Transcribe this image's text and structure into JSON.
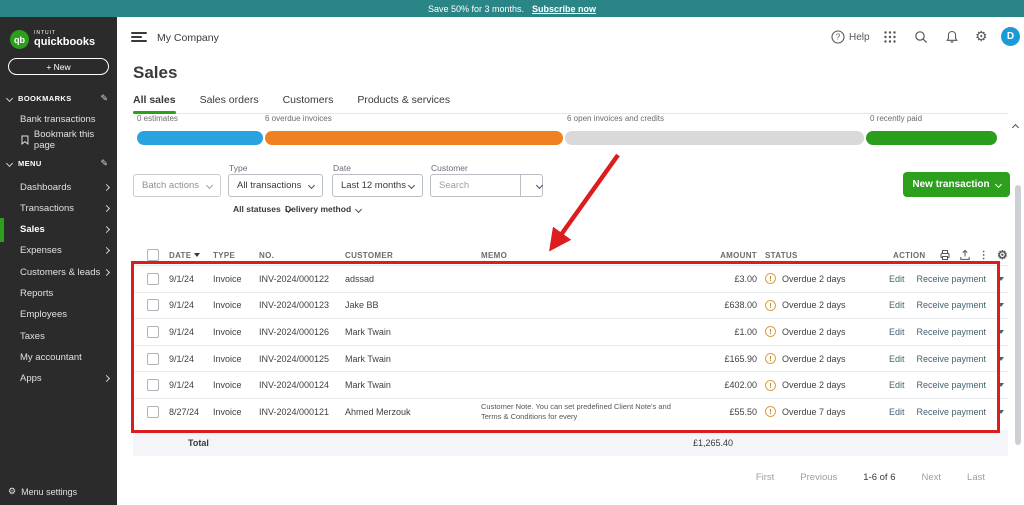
{
  "banner": {
    "text": "Save 50% for 3 months.",
    "link": "Subscribe now"
  },
  "sidebar": {
    "brand_top": "INTUIT",
    "brand_name": "quickbooks",
    "new_button": "+ New",
    "bookmarks_header": "BOOKMARKS",
    "bookmark_items": [
      "Bank transactions",
      "Bookmark this page"
    ],
    "menu_header": "MENU",
    "menu_items": [
      {
        "label": "Dashboards",
        "expandable": true,
        "active": false
      },
      {
        "label": "Transactions",
        "expandable": true,
        "active": false
      },
      {
        "label": "Sales",
        "expandable": true,
        "active": true
      },
      {
        "label": "Expenses",
        "expandable": true,
        "active": false
      },
      {
        "label": "Customers & leads",
        "expandable": true,
        "active": false
      },
      {
        "label": "Reports",
        "expandable": false,
        "active": false
      },
      {
        "label": "Employees",
        "expandable": false,
        "active": false
      },
      {
        "label": "Taxes",
        "expandable": false,
        "active": false
      },
      {
        "label": "My accountant",
        "expandable": false,
        "active": false
      },
      {
        "label": "Apps",
        "expandable": true,
        "active": false
      }
    ],
    "menu_settings": "Menu settings"
  },
  "topbar": {
    "company": "My Company",
    "help_label": "Help",
    "avatar_initial": "D"
  },
  "page_title": "Sales",
  "tabs": [
    {
      "label": "All sales",
      "active": true
    },
    {
      "label": "Sales orders",
      "active": false
    },
    {
      "label": "Customers",
      "active": false
    },
    {
      "label": "Products & services",
      "active": false
    }
  ],
  "money_bar": {
    "segments": [
      {
        "label": "0 estimates",
        "color": "#29a3e0",
        "width_pct": 14.7,
        "label_left": 20
      },
      {
        "label": "6 overdue invoices",
        "color": "#ef8122",
        "width_pct": 35.0,
        "label_left": 148
      },
      {
        "label": "6 open invoices and credits",
        "color": "#d9d9d9",
        "width_pct": 35.0,
        "label_left": 450
      },
      {
        "label": "0 recently paid",
        "color": "#2a9e1c",
        "width_pct": 15.3,
        "label_left": 753
      }
    ]
  },
  "filters": {
    "batch_actions": "Batch actions",
    "type_label": "Type",
    "type_value": "All transactions",
    "date_label": "Date",
    "date_value": "Last 12 months",
    "customer_label": "Customer",
    "customer_placeholder": "Search",
    "status_filter": "All statuses",
    "delivery_filter": "Delivery method"
  },
  "new_transaction_button": "New transaction",
  "table": {
    "headers": {
      "date": "DATE",
      "type": "TYPE",
      "no": "NO.",
      "customer": "CUSTOMER",
      "memo": "MEMO",
      "amount": "AMOUNT",
      "status": "STATUS",
      "action": "ACTION"
    },
    "rows": [
      {
        "date": "9/1/24",
        "type": "Invoice",
        "no": "INV-2024/000122",
        "customer": "adssad",
        "memo": "",
        "amount": "£3.00",
        "status": "Overdue 2 days",
        "actions": [
          "Edit",
          "Receive payment"
        ]
      },
      {
        "date": "9/1/24",
        "type": "Invoice",
        "no": "INV-2024/000123",
        "customer": "Jake BB",
        "memo": "",
        "amount": "£638.00",
        "status": "Overdue 2 days",
        "actions": [
          "Edit",
          "Receive payment"
        ]
      },
      {
        "date": "9/1/24",
        "type": "Invoice",
        "no": "INV-2024/000126",
        "customer": "Mark Twain",
        "memo": "",
        "amount": "£1.00",
        "status": "Overdue 2 days",
        "actions": [
          "Edit",
          "Receive payment"
        ]
      },
      {
        "date": "9/1/24",
        "type": "Invoice",
        "no": "INV-2024/000125",
        "customer": "Mark Twain",
        "memo": "",
        "amount": "£165.90",
        "status": "Overdue 2 days",
        "actions": [
          "Edit",
          "Receive payment"
        ]
      },
      {
        "date": "9/1/24",
        "type": "Invoice",
        "no": "INV-2024/000124",
        "customer": "Mark Twain",
        "memo": "",
        "amount": "£402.00",
        "status": "Overdue 2 days",
        "actions": [
          "Edit",
          "Receive payment"
        ]
      },
      {
        "date": "8/27/24",
        "type": "Invoice",
        "no": "INV-2024/000121",
        "customer": "Ahmed Merzouk",
        "memo": "Customer Note. You can set predefined Client Note's and Terms & Conditions for every",
        "amount": "£55.50",
        "status": "Overdue 7 days",
        "actions": [
          "Edit",
          "Receive payment"
        ]
      }
    ],
    "total_label": "Total",
    "total_amount": "£1,265.40"
  },
  "pagination": {
    "first": "First",
    "previous": "Previous",
    "range": "1-6 of 6",
    "next": "Next",
    "last": "Last"
  },
  "colors": {
    "accent_green": "#2ca01c",
    "banner_teal": "#2a8686",
    "annotation_red": "#dd1d1d"
  }
}
